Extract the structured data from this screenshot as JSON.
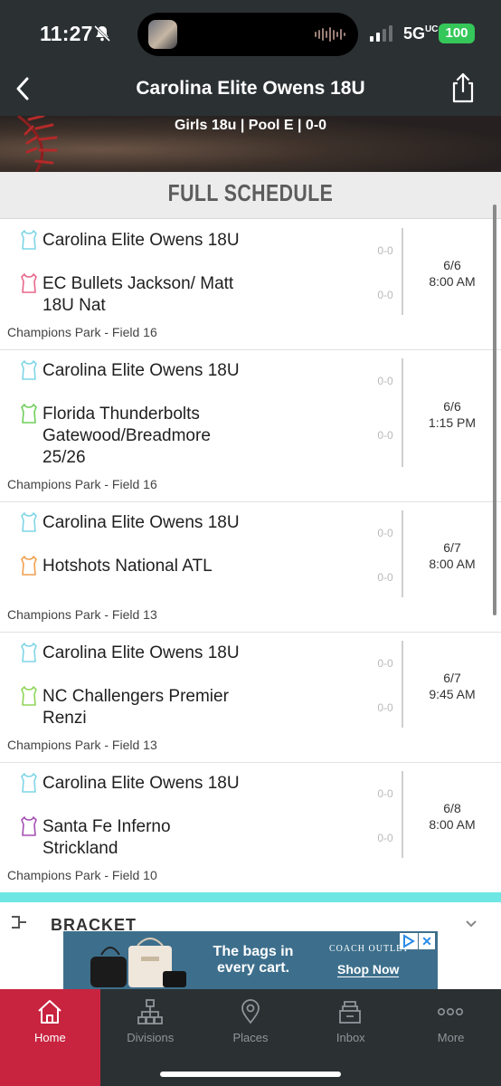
{
  "status": {
    "time": "11:27",
    "network": "5G",
    "network_suffix": "UC",
    "battery": "100"
  },
  "nav": {
    "title": "Carolina Elite Owens 18U"
  },
  "hero": {
    "subtitle": "Girls 18u | Pool E | 0-0"
  },
  "section": {
    "title": "FULL SCHEDULE"
  },
  "games": [
    {
      "home": "Carolina Elite Owens 18U",
      "home_color": "#7fd6e6",
      "home_score": "0-0",
      "away": "EC Bullets Jackson/ Matt 18U Nat",
      "away_color": "#e8678a",
      "away_score": "0-0",
      "date": "6/6",
      "time": "8:00 AM",
      "venue": "Champions Park - Field 16"
    },
    {
      "home": "Carolina Elite Owens 18U",
      "home_color": "#7fd6e6",
      "home_score": "0-0",
      "away": "Florida Thunderbolts Gatewood/Breadmore 25/26",
      "away_color": "#6fcf5a",
      "away_score": "0-0",
      "date": "6/6",
      "time": "1:15 PM",
      "venue": "Champions Park - Field 16"
    },
    {
      "home": "Carolina Elite Owens 18U",
      "home_color": "#7fd6e6",
      "home_score": "0-0",
      "away": "Hotshots National ATL",
      "away_color": "#f0a050",
      "away_score": "0-0",
      "date": "6/7",
      "time": "8:00 AM",
      "venue": "Champions Park - Field 13"
    },
    {
      "home": "Carolina Elite Owens 18U",
      "home_color": "#7fd6e6",
      "home_score": "0-0",
      "away": "NC Challengers Premier Renzi",
      "away_color": "#8fd65a",
      "away_score": "0-0",
      "date": "6/7",
      "time": "9:45 AM",
      "venue": "Champions Park - Field 13"
    },
    {
      "home": "Carolina Elite Owens 18U",
      "home_color": "#7fd6e6",
      "home_score": "0-0",
      "away": "Santa Fe Inferno Strickland",
      "away_color": "#a64fb4",
      "away_score": "0-0",
      "date": "6/8",
      "time": "8:00 AM",
      "venue": "Champions Park - Field 10"
    }
  ],
  "bracket": {
    "label": "BRACKET"
  },
  "ad": {
    "headline": "The bags in every cart.",
    "brand": "COACH OUTLET",
    "cta": "Shop Now"
  },
  "tabs": [
    {
      "label": "Home",
      "icon": "home-icon",
      "active": true
    },
    {
      "label": "Divisions",
      "icon": "divisions-icon",
      "active": false
    },
    {
      "label": "Places",
      "icon": "places-icon",
      "active": false
    },
    {
      "label": "Inbox",
      "icon": "inbox-icon",
      "active": false
    },
    {
      "label": "More",
      "icon": "more-icon",
      "active": false
    }
  ],
  "colors": {
    "header_bg": "#2b3033",
    "active_tab": "#c8243f",
    "accent_teal": "#6ee7e4"
  }
}
